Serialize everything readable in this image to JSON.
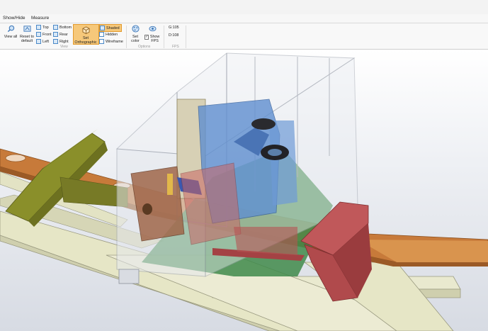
{
  "tabs": [
    "Show/Hide",
    "Measure"
  ],
  "ribbon": {
    "view_group": {
      "label": "View",
      "view_all": "View all",
      "reset_default": "Reset to default",
      "top": "Top",
      "front": "Front",
      "left": "Left",
      "bottom": "Bottom",
      "rear": "Rear",
      "right": "Right",
      "set_orthographic": "Set Orthographic",
      "shaded": "Shaded",
      "hidden": "Hidden",
      "wireframe": "Wireframe"
    },
    "options_group": {
      "label": "Options",
      "set_color": "Set color",
      "show_fps": "Show FPS"
    },
    "fps_group": {
      "label": "FPS",
      "g_value": "G:105",
      "d_value": "D:108"
    }
  },
  "colors": {
    "accent_active": "#f6c87a",
    "conveyor_orange": "#c77a3a",
    "guard_olive": "#8a8f2a",
    "gantry_red": "#c0585a",
    "part_blue": "#5f8fd0",
    "base_green": "#3f8a4a",
    "rail_cream": "#e6e6c6"
  }
}
